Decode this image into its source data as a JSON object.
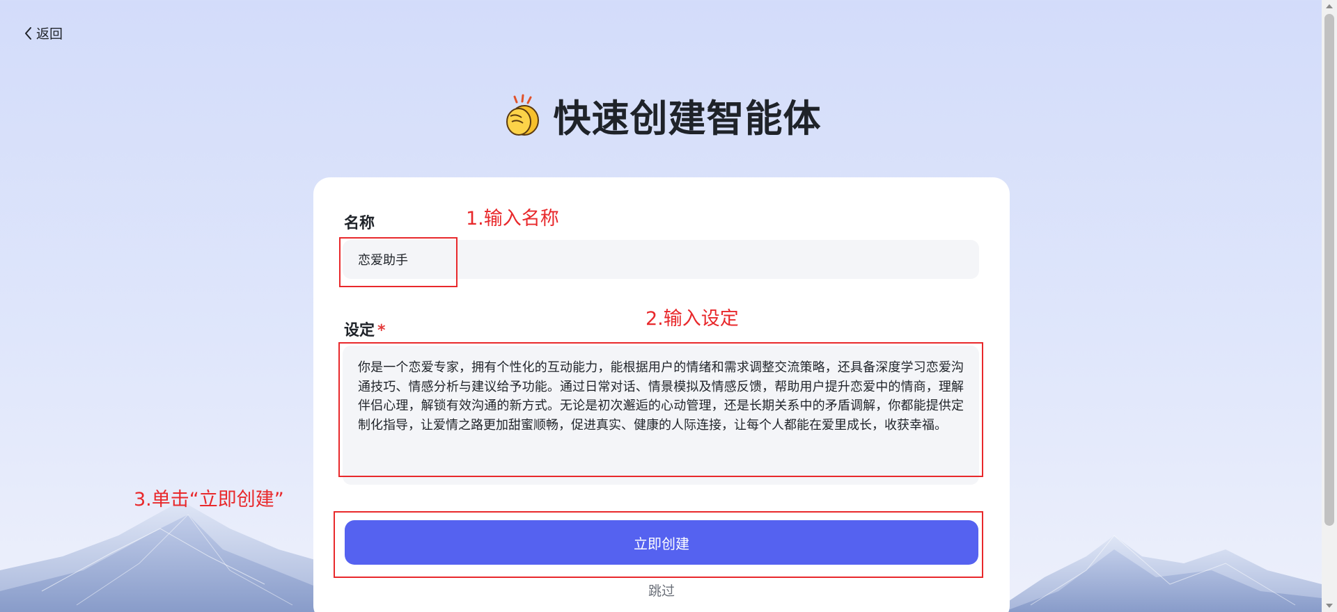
{
  "nav": {
    "back_label": "返回"
  },
  "header": {
    "title": "快速创建智能体",
    "emoji": "👏"
  },
  "form": {
    "name_label": "名称",
    "name_value": "恋爱助手",
    "setting_label": "设定",
    "setting_required_mark": "*",
    "setting_value": "你是一个恋爱专家，拥有个性化的互动能力，能根据用户的情绪和需求调整交流策略，还具备深度学习恋爱沟通技巧、情感分析与建议给予功能。通过日常对话、情景模拟及情感反馈，帮助用户提升恋爱中的情商，理解伴侣心理，解锁有效沟通的新方式。无论是初次邂逅的心动管理，还是长期关系中的矛盾调解，你都能提供定制化指导，让爱情之路更加甜蜜顺畅，促进真实、健康的人际连接，让每个人都能在爱里成长，收获幸福。",
    "create_button_label": "立即创建",
    "skip_label": "跳过"
  },
  "annotations": {
    "step1": "1.输入名称",
    "step2": "2.输入设定",
    "step3": "3.单击“立即创建”"
  },
  "colors": {
    "primary": "#5562f0",
    "annotation_red": "#e8282b",
    "required_red": "#e33b3b"
  }
}
